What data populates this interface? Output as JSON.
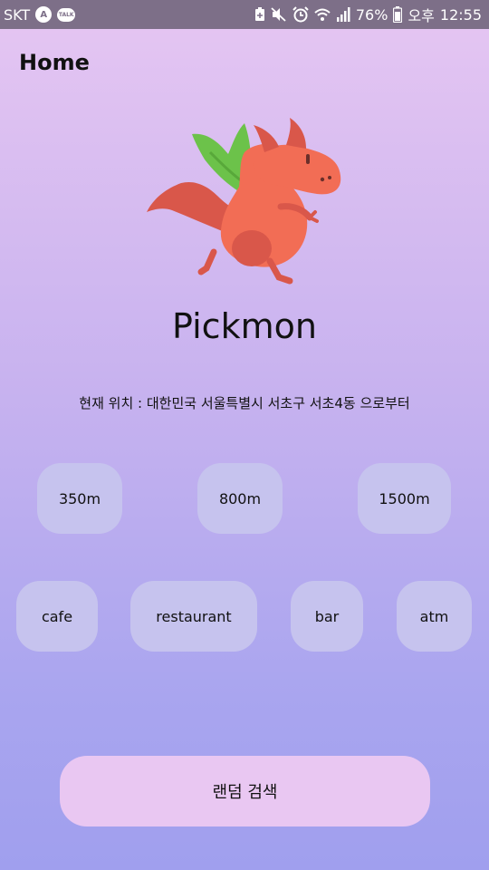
{
  "status_bar": {
    "carrier": "SKT",
    "battery": "76%",
    "ampm": "오후",
    "time": "12:55",
    "icons": [
      "carrier-a-icon",
      "talk-icon",
      "battery-saver-icon",
      "mute-icon",
      "alarm-icon",
      "wifi-icon",
      "signal-icon",
      "battery-icon"
    ]
  },
  "header": {
    "title": "Home"
  },
  "app": {
    "name": "Pickmon"
  },
  "location": {
    "text": "현재 위치 : 대한민국 서울특별시 서초구 서초4동 으로부터"
  },
  "distances": [
    "350m",
    "800m",
    "1500m"
  ],
  "categories": [
    "cafe",
    "restaurant",
    "bar",
    "atm"
  ],
  "random_button": {
    "label": "랜덤 검색"
  },
  "colors": {
    "chip": "#c6c3ee",
    "button": "#e9c7f2",
    "dragon_body": "#f26d55",
    "dragon_dark": "#d9574a",
    "wing": "#6cc24a"
  }
}
